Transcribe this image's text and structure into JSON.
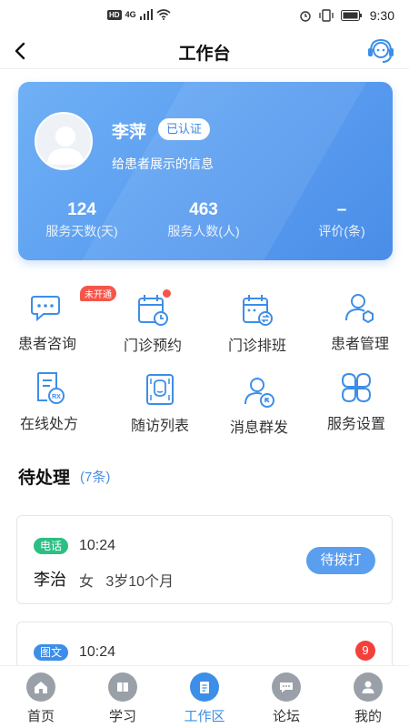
{
  "status_bar": {
    "network": "HD",
    "signal": "4G",
    "time": "9:30"
  },
  "nav": {
    "title": "工作台"
  },
  "profile": {
    "name": "李萍",
    "badge": "已认证",
    "description": "给患者展示的信息",
    "stats": [
      {
        "value": "124",
        "label": "服务天数(天)"
      },
      {
        "value": "463",
        "label": "服务人数(人)"
      },
      {
        "value": "–",
        "label": "评价(条)"
      }
    ]
  },
  "functions": [
    {
      "label": "患者咨询",
      "icon": "chat-icon",
      "tag": "未开通"
    },
    {
      "label": "门诊预约",
      "icon": "calendar-clock-icon",
      "dot": true
    },
    {
      "label": "门诊排班",
      "icon": "calendar-swap-icon"
    },
    {
      "label": "患者管理",
      "icon": "user-manage-icon"
    },
    {
      "label": "在线处方",
      "icon": "prescription-icon"
    },
    {
      "label": "随访列表",
      "icon": "followup-icon"
    },
    {
      "label": "消息群发",
      "icon": "broadcast-user-icon"
    },
    {
      "label": "服务设置",
      "icon": "clover-settings-icon"
    }
  ],
  "pending": {
    "title": "待处理",
    "count": "(7条)",
    "items": [
      {
        "type": "电话",
        "time": "10:24",
        "name": "李治",
        "gender": "女",
        "age": "3岁10个月",
        "action": "待拨打"
      },
      {
        "type": "图文",
        "time": "10:24",
        "badge": "9"
      }
    ]
  },
  "tabs": [
    {
      "label": "首页",
      "icon": "home-icon"
    },
    {
      "label": "学习",
      "icon": "book-icon"
    },
    {
      "label": "工作区",
      "icon": "clipboard-icon",
      "active": true
    },
    {
      "label": "论坛",
      "icon": "forum-icon"
    },
    {
      "label": "我的",
      "icon": "person-icon"
    }
  ],
  "colors": {
    "primary": "#3d8ee8",
    "card_gradient_start": "#6fb0f5",
    "card_gradient_end": "#4a8de8",
    "alert_red": "#f5564b",
    "phone_green": "#2cbf83"
  }
}
